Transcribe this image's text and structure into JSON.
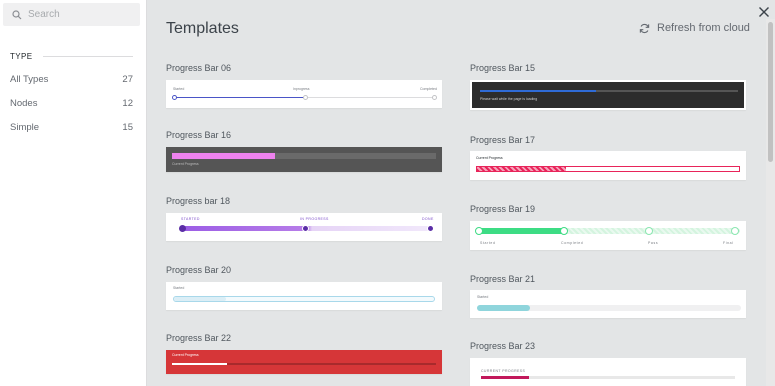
{
  "sidebar": {
    "search_placeholder": "Search",
    "section_label": "TYPE",
    "filters": [
      {
        "label": "All Types",
        "count": "27"
      },
      {
        "label": "Nodes",
        "count": "12"
      },
      {
        "label": "Simple",
        "count": "15"
      }
    ]
  },
  "header": {
    "title": "Templates",
    "refresh_label": "Refresh from cloud"
  },
  "templates": [
    {
      "name": "Progress Bar 06",
      "texts": [
        "Started",
        "Inprogress",
        "Completed"
      ]
    },
    {
      "name": "Progress Bar 15",
      "texts": [
        "Please wait while the page is loading"
      ],
      "progress": 0.45,
      "colors": {
        "bg": "#2c2c2c",
        "fill": "#2f6bd6"
      }
    },
    {
      "name": "Progress Bar 16",
      "texts": [
        "Current Progress"
      ],
      "progress": 0.39,
      "colors": {
        "bg": "#555555",
        "fill": "#ee82ee"
      }
    },
    {
      "name": "Progress Bar 17",
      "texts": [
        "Current Progress"
      ],
      "progress": 0.34,
      "colors": {
        "fill": "#e8245a"
      }
    },
    {
      "name": "Progress bar 18",
      "texts": [
        "STARTED",
        "IN PROGRESS",
        "DONE"
      ],
      "colors": {
        "fill": "#9b5de5"
      }
    },
    {
      "name": "Progress Bar 19",
      "texts": [
        "Started",
        "Completed",
        "Pass",
        "Final"
      ],
      "colors": {
        "fill": "#3ddc84"
      }
    },
    {
      "name": "Progress Bar 20",
      "texts": [
        "Started"
      ]
    },
    {
      "name": "Progress Bar 21",
      "texts": [
        "Started"
      ],
      "progress": 0.2,
      "colors": {
        "fill": "#8fd5dc"
      }
    },
    {
      "name": "Progress Bar 22",
      "texts": [
        "Current Progress"
      ],
      "progress": 0.21,
      "colors": {
        "bg": "#d63638"
      }
    },
    {
      "name": "Progress Bar 23",
      "texts": [
        "CURRENT PROGRESS"
      ],
      "progress": 0.19,
      "colors": {
        "fill": "#c2185b"
      }
    }
  ]
}
